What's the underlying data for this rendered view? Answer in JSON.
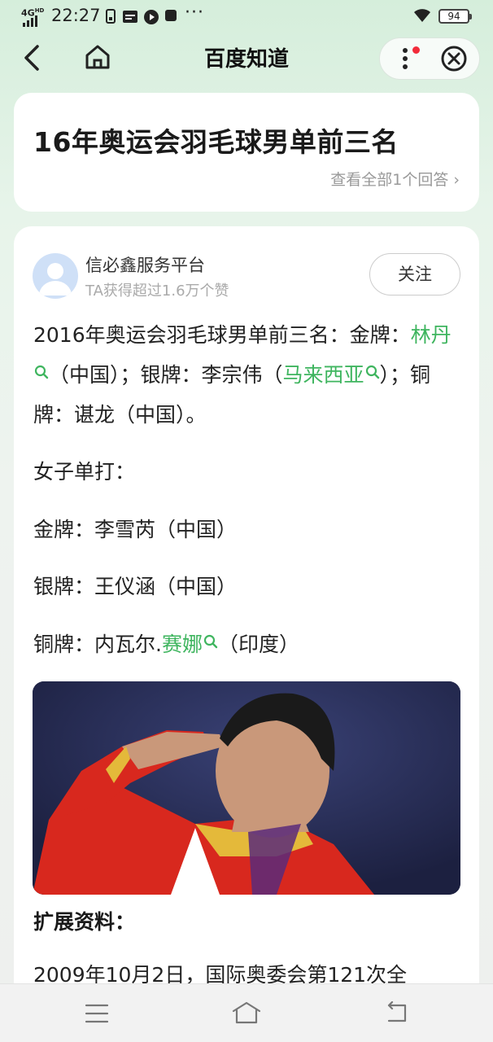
{
  "status_bar": {
    "network": "4G",
    "network_sup": "HD",
    "time": "22:27",
    "more": "···",
    "battery": "94",
    "icons": [
      "sim-icon",
      "calendar-icon",
      "media-icon",
      "stop-icon",
      "wifi-icon",
      "battery-icon"
    ]
  },
  "nav": {
    "title": "百度知道",
    "icons": [
      "back-icon",
      "home-icon",
      "more-icon",
      "close-icon"
    ]
  },
  "question": {
    "title": "16年奥运会羽毛球男单前三名",
    "view_all": "查看全部1个回答"
  },
  "answer": {
    "author_name": "信必鑫服务平台",
    "author_stats": "TA获得超过1.6万个赞",
    "follow_label": "关注",
    "p1": {
      "t1": "2016年奥运会羽毛球男单前三名：金牌：",
      "link1": "林丹",
      "t2": "（中国）；银牌：李宗伟（",
      "link2": "马来西亚",
      "t3": "）；铜牌：谌龙（中国）。"
    },
    "p2": "女子单打：",
    "p3": "金牌：李雪芮（中国）",
    "p4": "银牌：王仪涵（中国）",
    "p5": {
      "t1": "铜牌：内瓦尔.",
      "link": "赛娜",
      "t2": "（印度）"
    },
    "extended_heading": "扩展资料：",
    "p_last": "2009年10月2日，国际奥委会第121次全"
  },
  "colors": {
    "link": "#3fb55f",
    "background_top": "#d5eedb",
    "card": "#ffffff",
    "notification_dot": "#f22b3a"
  }
}
